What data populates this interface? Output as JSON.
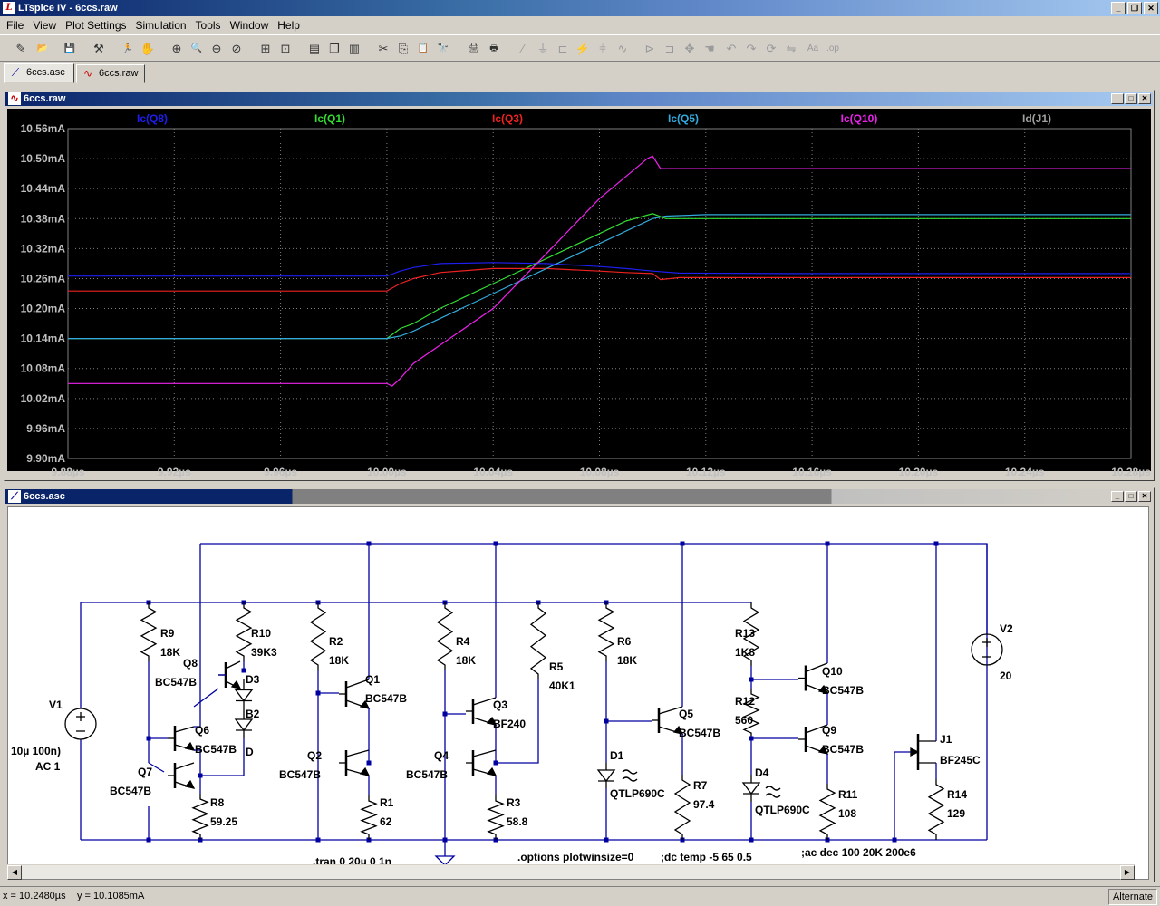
{
  "app": {
    "title": "LTspice IV - 6ccs.raw",
    "logo": "LTspice-logo"
  },
  "menu": [
    "File",
    "View",
    "Plot Settings",
    "Simulation",
    "Tools",
    "Window",
    "Help"
  ],
  "toolbar": [
    {
      "icon": "new-schematic-icon",
      "glyph": "✎"
    },
    {
      "icon": "open-icon",
      "glyph": "📂"
    },
    {
      "icon": "save-icon",
      "glyph": "💾"
    },
    {
      "icon": "control-panel-icon",
      "glyph": "⚒"
    },
    {
      "icon": "run-icon",
      "glyph": "🏃"
    },
    {
      "icon": "halt-icon",
      "glyph": "✋"
    },
    {
      "icon": "zoom-in-icon",
      "glyph": "⊕"
    },
    {
      "icon": "zoom-pan-icon",
      "glyph": "🔍"
    },
    {
      "icon": "zoom-out-icon",
      "glyph": "⊖"
    },
    {
      "icon": "zoom-cancel-icon",
      "glyph": "⊘"
    },
    {
      "icon": "autorange-icon",
      "glyph": "⊞"
    },
    {
      "icon": "zoom-fit-icon",
      "glyph": "⊡"
    },
    {
      "icon": "tile-horizontal-icon",
      "glyph": "▤"
    },
    {
      "icon": "cascade-icon",
      "glyph": "❐"
    },
    {
      "icon": "tile-vertical-icon",
      "glyph": "▥"
    },
    {
      "icon": "cut-icon",
      "glyph": "✂"
    },
    {
      "icon": "copy-icon",
      "glyph": "⎘"
    },
    {
      "icon": "paste-icon",
      "glyph": "📋"
    },
    {
      "icon": "find-icon",
      "glyph": "🔭"
    },
    {
      "icon": "print-setup-icon",
      "glyph": "🖨"
    },
    {
      "icon": "print-icon",
      "glyph": "🖶"
    },
    {
      "icon": "wire-icon",
      "glyph": "∕"
    },
    {
      "icon": "ground-icon",
      "glyph": "⏚"
    },
    {
      "icon": "label-icon",
      "glyph": "⊏"
    },
    {
      "icon": "resistor-icon",
      "glyph": "⚡"
    },
    {
      "icon": "capacitor-icon",
      "glyph": "⫩"
    },
    {
      "icon": "inductor-icon",
      "glyph": "∿"
    },
    {
      "icon": "diode-icon",
      "glyph": "⊳"
    },
    {
      "icon": "component-icon",
      "glyph": "⊐"
    },
    {
      "icon": "move-icon",
      "glyph": "✥"
    },
    {
      "icon": "drag-icon",
      "glyph": "☚"
    },
    {
      "icon": "undo-icon",
      "glyph": "↶"
    },
    {
      "icon": "redo-icon",
      "glyph": "↷"
    },
    {
      "icon": "rotate-icon",
      "glyph": "⟳"
    },
    {
      "icon": "mirror-icon",
      "glyph": "⇋"
    },
    {
      "icon": "text-icon",
      "glyph": "Aa"
    },
    {
      "icon": "spice-directive-icon",
      "glyph": ".op"
    }
  ],
  "tabs": [
    {
      "label": "6ccs.asc",
      "icon": "schematic-icon",
      "active": true
    },
    {
      "label": "6ccs.raw",
      "icon": "waveform-icon",
      "active": false
    }
  ],
  "plot": {
    "title": "6ccs.raw",
    "background": "#000000",
    "grid_color": "#808080"
  },
  "chart_data": {
    "type": "line",
    "x_ticks": [
      "9.88µs",
      "9.92µs",
      "9.96µs",
      "10.00µs",
      "10.04µs",
      "10.08µs",
      "10.12µs",
      "10.16µs",
      "10.20µs",
      "10.24µs",
      "10.28µs"
    ],
    "y_ticks": [
      "10.56mA",
      "10.50mA",
      "10.44mA",
      "10.38mA",
      "10.32mA",
      "10.26mA",
      "10.20mA",
      "10.14mA",
      "10.08mA",
      "10.02mA",
      "9.96mA",
      "9.90mA"
    ],
    "xlim": [
      9.88,
      10.28
    ],
    "ylim": [
      9.9,
      10.56
    ],
    "grid": true,
    "series": [
      {
        "name": "Ic(Q8)",
        "color": "#1e1ef0",
        "x": [
          9.88,
          10.0,
          10.005,
          10.01,
          10.02,
          10.04,
          10.06,
          10.08,
          10.09,
          10.1,
          10.11,
          10.15,
          10.28
        ],
        "y": [
          10.265,
          10.265,
          10.275,
          10.282,
          10.29,
          10.292,
          10.29,
          10.284,
          10.28,
          10.275,
          10.271,
          10.27,
          10.27
        ]
      },
      {
        "name": "Ic(Q1)",
        "color": "#33dd33",
        "x": [
          9.88,
          10.0,
          10.005,
          10.01,
          10.02,
          10.04,
          10.06,
          10.08,
          10.09,
          10.1,
          10.105,
          10.15,
          10.28
        ],
        "y": [
          10.14,
          10.14,
          10.16,
          10.17,
          10.2,
          10.25,
          10.3,
          10.35,
          10.375,
          10.39,
          10.38,
          10.38,
          10.38
        ]
      },
      {
        "name": "Ic(Q3)",
        "color": "#ee2222",
        "x": [
          9.88,
          10.0,
          10.005,
          10.01,
          10.02,
          10.04,
          10.06,
          10.08,
          10.09,
          10.1,
          10.103,
          10.11,
          10.28
        ],
        "y": [
          10.235,
          10.235,
          10.25,
          10.26,
          10.272,
          10.28,
          10.28,
          10.275,
          10.272,
          10.27,
          10.258,
          10.262,
          10.262
        ]
      },
      {
        "name": "Ic(Q5)",
        "color": "#33aadd",
        "x": [
          9.88,
          10.0,
          10.005,
          10.01,
          10.02,
          10.04,
          10.06,
          10.08,
          10.1,
          10.105,
          10.12,
          10.28
        ],
        "y": [
          10.14,
          10.14,
          10.145,
          10.155,
          10.18,
          10.23,
          10.28,
          10.33,
          10.38,
          10.385,
          10.388,
          10.388
        ]
      },
      {
        "name": "Ic(Q10)",
        "color": "#ee22ee",
        "x": [
          9.88,
          10.0,
          10.002,
          10.005,
          10.01,
          10.04,
          10.06,
          10.08,
          10.098,
          10.1,
          10.103,
          10.28
        ],
        "y": [
          10.05,
          10.05,
          10.045,
          10.06,
          10.09,
          10.2,
          10.31,
          10.42,
          10.5,
          10.505,
          10.48,
          10.48
        ]
      },
      {
        "name": "Id(J1)",
        "color": "#a0a0a0",
        "x": [],
        "y": []
      }
    ]
  },
  "schematic": {
    "title": "6ccs.asc",
    "components": [
      "V1",
      "R9",
      "Q8",
      "R10",
      "D3",
      "D",
      "B2",
      "Q6",
      "Q7",
      "R8",
      "R2",
      "Q1",
      "Q2",
      "R1",
      "R4",
      "Q3",
      "Q4",
      "R3",
      "R5",
      "R6",
      "D1",
      "Q5",
      "R7",
      "R13",
      "Q10",
      "R12",
      "Q9",
      "D4",
      "R11",
      "V2",
      "J1",
      "R14"
    ],
    "labels": {
      "V1": "V1",
      "V1_value": "10µ 100n)",
      "V1_ac": "AC 1",
      "R9": "R9",
      "R9_value": "18K",
      "Q8": "Q8",
      "Q8_model": "BC547B",
      "R10": "R10",
      "R10_value": "39K3",
      "D3": "D3",
      "B2": "B2",
      "D": "D",
      "Q6": "Q6",
      "Q6_model": "BC547B",
      "Q7": "Q7",
      "Q7_model": "BC547B",
      "R8": "R8",
      "R8_value": "59.25",
      "R2": "R2",
      "R2_value": "18K",
      "Q1": "Q1",
      "Q1_model": "BC547B",
      "Q2": "Q2",
      "Q2_model": "BC547B",
      "R1": "R1",
      "R1_value": "62",
      "R4": "R4",
      "R4_value": "18K",
      "Q3": "Q3",
      "Q3_model": "BF240",
      "Q4": "Q4",
      "Q4_model": "BC547B",
      "R3": "R3",
      "R3_value": "58.8",
      "R5": "R5",
      "R5_value": "40K1",
      "R6": "R6",
      "R6_value": "18K",
      "D1": "D1",
      "D1_model": "QTLP690C",
      "Q5": "Q5",
      "Q5_model": "BC547B",
      "R7": "R7",
      "R7_value": "97.4",
      "R13": "R13",
      "R13_value": "1K8",
      "Q10": "Q10",
      "Q10_model": "BC547B",
      "R12": "R12",
      "R12_value": "560",
      "Q9": "Q9",
      "Q9_model": "BC547B",
      "D4": "D4",
      "D4_model": "QTLP690C",
      "R11": "R11",
      "R11_value": "108",
      "V2": "V2",
      "V2_value": "20",
      "J1": "J1",
      "J1_model": "BF245C",
      "R14": "R14",
      "R14_value": "129"
    },
    "directives": {
      "tran": ".tran 0 20µ 0 1n",
      "options": ".options plotwinsize=0",
      "dc": ";dc temp -5 65 0.5",
      "ac": ";ac dec 100 20K 200e6"
    },
    "wire_color": "#0000a0",
    "component_color": "#000000"
  },
  "status": {
    "x": "x = 10.2480µs",
    "y": "y = 10.1085mA",
    "mode": "Alternate"
  }
}
